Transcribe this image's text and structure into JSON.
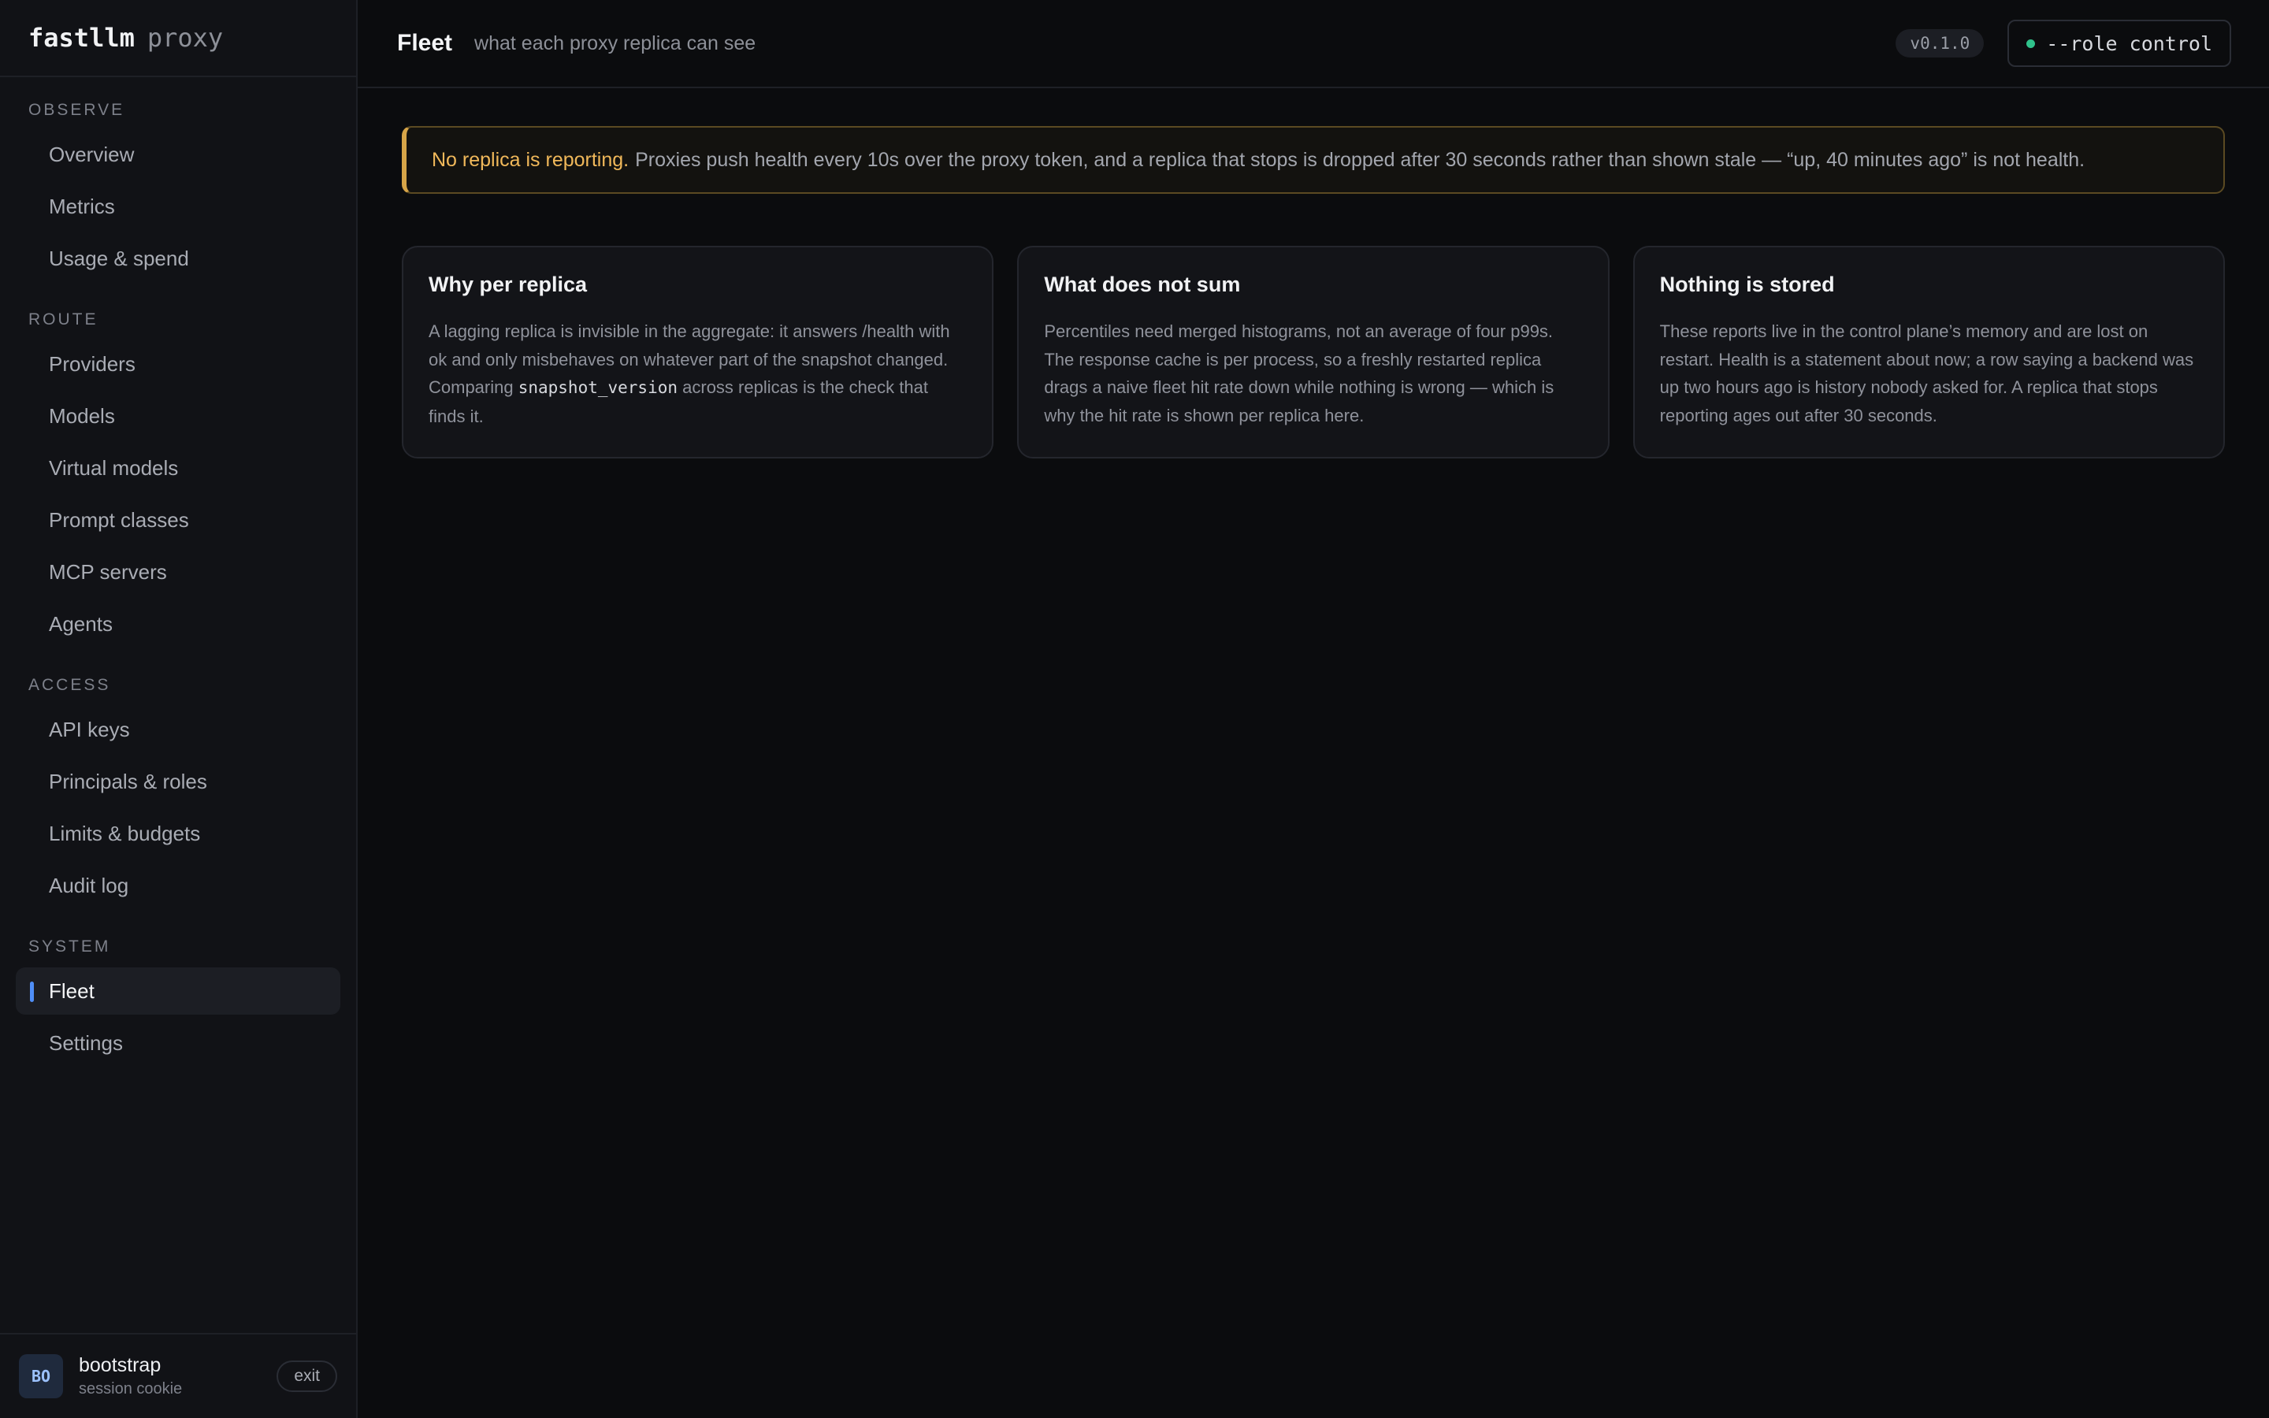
{
  "brand": {
    "name": "fastllm",
    "suffix": "proxy"
  },
  "sidebar": {
    "sections": [
      {
        "heading": "OBSERVE",
        "items": [
          "Overview",
          "Metrics",
          "Usage & spend"
        ]
      },
      {
        "heading": "ROUTE",
        "items": [
          "Providers",
          "Models",
          "Virtual models",
          "Prompt classes",
          "MCP servers",
          "Agents"
        ]
      },
      {
        "heading": "ACCESS",
        "items": [
          "API keys",
          "Principals & roles",
          "Limits & budgets",
          "Audit log"
        ]
      },
      {
        "heading": "SYSTEM",
        "items": [
          "Fleet",
          "Settings"
        ]
      }
    ],
    "active_item": "Fleet"
  },
  "user": {
    "initials": "BO",
    "name": "bootstrap",
    "session": "session cookie",
    "exit_label": "exit"
  },
  "header": {
    "title": "Fleet",
    "subtitle": "what each proxy replica can see",
    "version": "v0.1.0",
    "role": "--role control"
  },
  "colors": {
    "accent": "#4f8ef7",
    "warning": "#f0b85a",
    "status_ok": "#2fc28b"
  },
  "banner": {
    "strong": "No replica is reporting.",
    "text": "Proxies push health every 10s over the proxy token, and a replica that stops is dropped after 30 seconds rather than shown stale — “up, 40 minutes ago” is not health."
  },
  "cards": [
    {
      "title": "Why per replica",
      "body_before": "A lagging replica is invisible in the aggregate: it answers /health with ok and only misbehaves on whatever part of the snapshot changed. Comparing ",
      "code": "snapshot_version",
      "body_after": " across replicas is the check that finds it."
    },
    {
      "title": "What does not sum",
      "body": "Percentiles need merged histograms, not an average of four p99s. The response cache is per process, so a freshly restarted replica drags a naive fleet hit rate down while nothing is wrong — which is why the hit rate is shown per replica here."
    },
    {
      "title": "Nothing is stored",
      "body": "These reports live in the control plane’s memory and are lost on restart. Health is a statement about now; a row saying a backend was up two hours ago is history nobody asked for. A replica that stops reporting ages out after 30 seconds."
    }
  ]
}
